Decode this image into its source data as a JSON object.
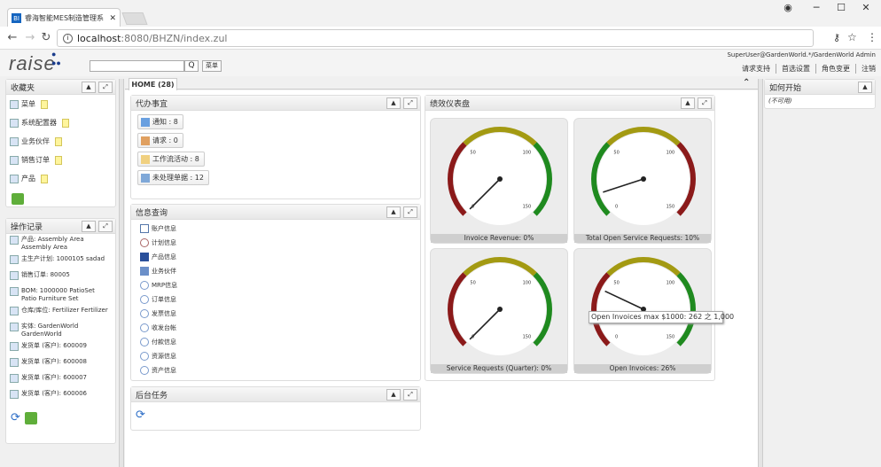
{
  "browser": {
    "tab_title": "睿海智能MES制造管理系",
    "favicon_text": "BI",
    "url_host": "localhost",
    "url_path": ":8080/BHZN/index.zul"
  },
  "header": {
    "logo": "raise",
    "search_button": "Q",
    "menu_button": "菜单",
    "user": "SuperUser@GardenWorld.*/GardenWorld Admin",
    "links": [
      "请求支持",
      "首选设置",
      "角色变更",
      "注销"
    ]
  },
  "favorites": {
    "title": "收藏夹",
    "items": [
      "菜单",
      "系统配置器",
      "业务伙伴",
      "销售订单",
      "产品"
    ]
  },
  "history": {
    "title": "操作记录",
    "items": [
      "产品: Assembly Area Assembly Area",
      "主生产计划: 1000105 sadad",
      "销售订单: 80005",
      "BOM: 1000000 PatioSet Patio Furniture Set",
      "仓库/库位: Fertilizer Fertilizer",
      "实体: GardenWorld GardenWorld",
      "发货单 (客户): 600009",
      "发货单 (客户): 600008",
      "发货单 (客户): 600007",
      "发货单 (客户): 600006"
    ]
  },
  "main": {
    "tab": "HOME (28)",
    "todo": {
      "title": "代办事宜",
      "buttons": [
        "通知 : 8",
        "请求 : 0",
        "工作流活动 : 8",
        "未处理单据 : 12"
      ]
    },
    "inquiry": {
      "title": "信息查询",
      "items": [
        "账户信息",
        "计划信息",
        "产品信息",
        "业务伙伴",
        "MRP信息",
        "订单信息",
        "发票信息",
        "收发台帐",
        "付款信息",
        "资源信息",
        "资产信息"
      ]
    },
    "background": {
      "title": "后台任务"
    },
    "dashboard": {
      "title": "绩效仪表盘",
      "gauges": [
        {
          "label": "Invoice Revenue: 0%",
          "value": 0
        },
        {
          "label": "Total Open Service Requests: 10%",
          "value": 10
        },
        {
          "label": "Service Requests (Quarter): 0%",
          "value": 0
        },
        {
          "label": "Open Invoices: 26%",
          "value": 26
        }
      ],
      "tick_labels": [
        "0",
        "50",
        "100",
        "150"
      ],
      "tooltip": "Open Invoices max $1000: 262 之 1,000"
    }
  },
  "right": {
    "title": "如何开始",
    "subtitle": "(不可用)"
  },
  "colors": {
    "red": "#8b1a1a",
    "olive": "#a39a12",
    "green": "#1f8a1f",
    "brand": "#1a3c8c"
  }
}
